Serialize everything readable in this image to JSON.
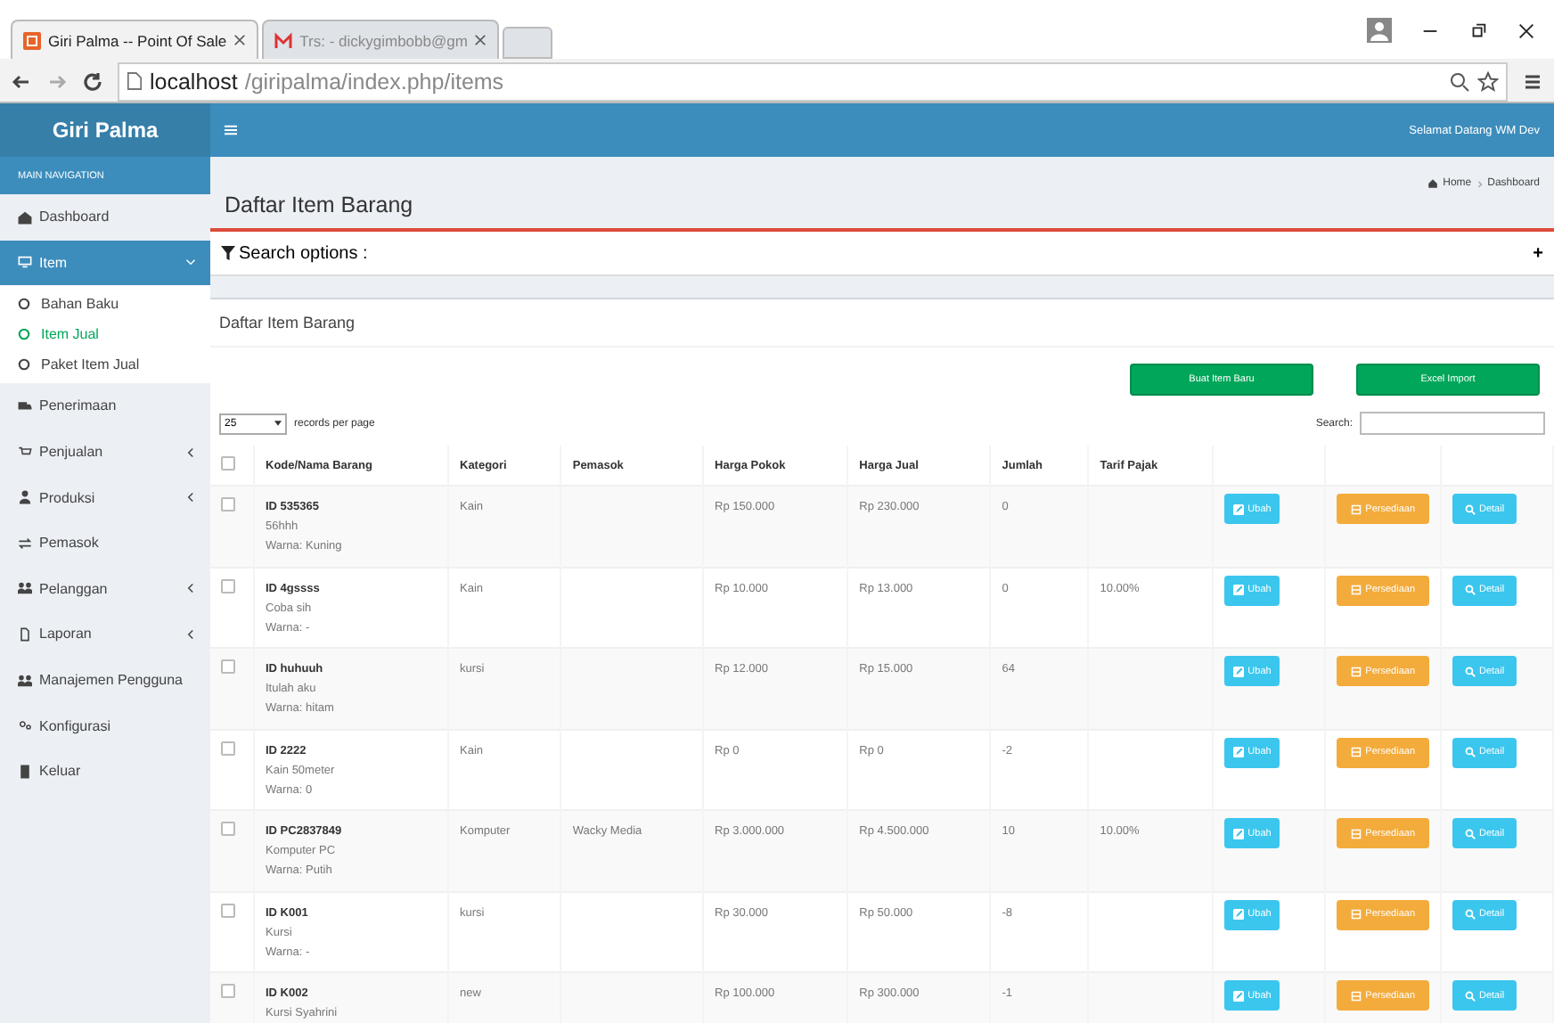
{
  "browser": {
    "tabs": [
      {
        "title": "Giri Palma -- Point Of Sale",
        "kind": "app",
        "selected": true
      },
      {
        "title": "Trs: - dickygimbobb@gm",
        "kind": "mail",
        "selected": false
      }
    ],
    "address": {
      "host": "localhost",
      "path": "/giripalma/index.php/items"
    }
  },
  "sidebar": {
    "brand": "Giri Palma",
    "section": "MAIN NAVIGATION",
    "items": [
      {
        "label": "Dashboard",
        "selected": false,
        "caret": false
      },
      {
        "label": "Item",
        "selected": true,
        "caret": true,
        "expanded": true,
        "children": [
          {
            "label": "Bahan Baku",
            "selected": false
          },
          {
            "label": "Item Jual",
            "selected": true
          },
          {
            "label": "Paket Item Jual",
            "selected": false
          }
        ]
      },
      {
        "label": "Penerimaan",
        "selected": false,
        "caret": false
      },
      {
        "label": "Penjualan",
        "selected": false,
        "caret": true,
        "expanded": false
      },
      {
        "label": "Produksi",
        "selected": false,
        "caret": true,
        "expanded": false
      },
      {
        "label": "Pemasok",
        "selected": false,
        "caret": false
      },
      {
        "label": "Pelanggan",
        "selected": false,
        "caret": true,
        "expanded": false
      },
      {
        "label": "Laporan",
        "selected": false,
        "caret": true,
        "expanded": false
      },
      {
        "label": "Manajemen Pengguna",
        "selected": false,
        "caret": false
      },
      {
        "label": "Konfigurasi",
        "selected": false,
        "caret": false
      },
      {
        "label": "Keluar",
        "selected": false,
        "caret": false
      }
    ]
  },
  "header": {
    "welcome": "Selamat Datang WM Dev"
  },
  "page": {
    "title": "Daftar Item Barang",
    "breadcrumb": [
      "Home",
      "Dashboard"
    ]
  },
  "search_options": {
    "label": "Search options :",
    "expand": "+"
  },
  "panel": {
    "title": "Daftar Item Barang",
    "buttons": [
      "Buat Item Baru",
      "Excel Import"
    ],
    "records_per_page": {
      "value": "25",
      "label": "records per page"
    },
    "search_label": "Search:"
  },
  "table": {
    "select_all_checked": false,
    "columns": [
      "Kode/Nama Barang",
      "Kategori",
      "Pemasok",
      "Harga Pokok",
      "Harga Jual",
      "Jumlah",
      "Tarif Pajak"
    ],
    "rows": [
      {
        "checked": false,
        "id": "ID 535365",
        "name": "56hhh",
        "warna": "Warna: Kuning",
        "kategori": "Kain",
        "harga_pokok": "Rp 150.000",
        "harga_jual": "Rp 230.000",
        "jumlah": "0",
        "actions": [
          "Ubah",
          "Persediaan",
          "Detail"
        ]
      },
      {
        "checked": false,
        "id": "ID 4gssss",
        "name": "Coba sih",
        "warna": "Warna: -",
        "kategori": "Kain",
        "harga_pokok": "Rp 10.000",
        "harga_jual": "Rp 13.000",
        "jumlah": "0",
        "tarif_pajak": "10.00%",
        "actions": [
          "Ubah",
          "Persediaan",
          "Detail"
        ]
      },
      {
        "checked": false,
        "id": "ID huhuuh",
        "name": "Itulah aku",
        "warna": "Warna: hitam",
        "kategori": "kursi",
        "harga_pokok": "Rp 12.000",
        "harga_jual": "Rp 15.000",
        "jumlah": "64",
        "actions": [
          "Ubah",
          "Persediaan",
          "Detail"
        ]
      },
      {
        "checked": false,
        "id": "ID 2222",
        "name": "Kain 50meter",
        "warna": "Warna: 0",
        "kategori": "Kain",
        "harga_pokok": "Rp 0",
        "harga_jual": "Rp 0",
        "jumlah": "-2",
        "actions": [
          "Ubah",
          "Persediaan",
          "Detail"
        ]
      },
      {
        "checked": false,
        "id": "ID PC2837849",
        "name": "Komputer PC",
        "warna": "Warna: Putih",
        "kategori": "Komputer",
        "pemasok": "Wacky Media",
        "harga_pokok": "Rp 3.000.000",
        "harga_jual": "Rp 4.500.000",
        "jumlah": "10",
        "tarif_pajak": "10.00%",
        "actions": [
          "Ubah",
          "Persediaan",
          "Detail"
        ]
      },
      {
        "checked": false,
        "id": "ID K001",
        "name": "Kursi",
        "warna": "Warna: -",
        "kategori": "kursi",
        "harga_pokok": "Rp 30.000",
        "harga_jual": "Rp 50.000",
        "jumlah": "-8",
        "actions": [
          "Ubah",
          "Persediaan",
          "Detail"
        ]
      },
      {
        "checked": false,
        "id": "ID K002",
        "name": "Kursi Syahrini",
        "kategori": "new",
        "harga_pokok": "Rp 100.000",
        "harga_jual": "Rp 300.000",
        "jumlah": "-1",
        "actions": [
          "Ubah",
          "Persediaan",
          "Detail"
        ]
      }
    ]
  }
}
